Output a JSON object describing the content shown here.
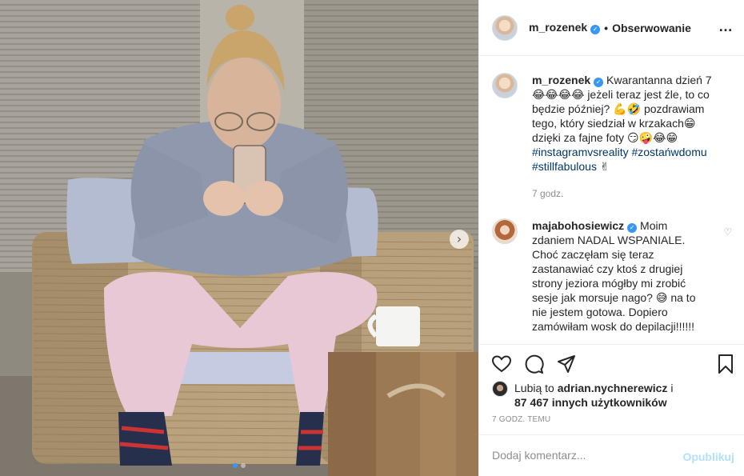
{
  "post": {
    "author": "m_rozenek",
    "follow_label": "Obserwowanie",
    "separator": "•",
    "more_icon": "…"
  },
  "photo": {
    "carousel_arrow": "›",
    "slides": 2,
    "active_slide": 1
  },
  "caption": {
    "author": "m_rozenek",
    "line1": "Kwarantanna dzień 7😂😂😂😂 jeżeli teraz jest źle, to co będzie później? 💪🤣 pozdrawiam tego, który siedział w krzakach😁 dzięki za fajne foty 😏🤪😂😁",
    "hashtags": "#instagramvsreality #zostańwdomu #stillfabulous",
    "hashtag_suffix": " ✌",
    "time": "7 godz."
  },
  "comment": {
    "author": "majabohosiewicz",
    "text": "Moim zdaniem NADAL WSPANIALE. Choć zaczęłam się teraz zastanawiać czy ktoś z drugiej strony jeziora mógłby mi zrobić sesje jak morsuje nago? 😅 na to nie jestem gotowa. Dopiero zamówiłam wosk do depilacji!!!!!!",
    "like_icon": "♡"
  },
  "likes": {
    "prefix": "Lubią to",
    "user": "adrian.nychnerewicz",
    "connector": "i",
    "count_text": "87 467 innych użytkowników"
  },
  "timestamp": "7 GODZ. TEMU",
  "add_comment": {
    "placeholder": "Dodaj komentarz...",
    "publish_label": "Opublikuj"
  },
  "colors": {
    "accent": "#3897f0",
    "hashtag": "#00376b",
    "muted": "#8e8e8e",
    "publish_disabled": "#b2dffc"
  }
}
